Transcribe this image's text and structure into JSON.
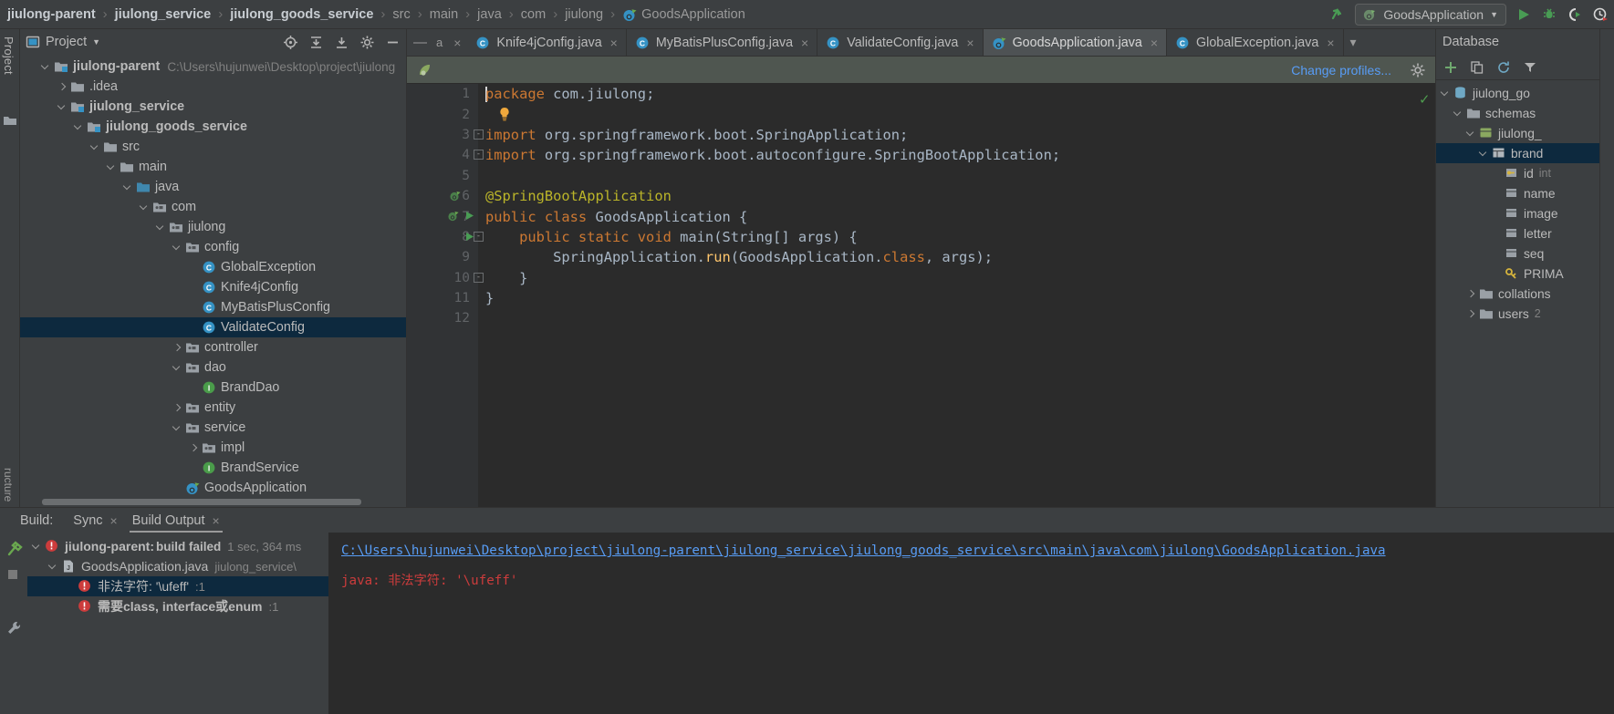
{
  "navbar": {
    "breadcrumbs": [
      {
        "label": "jiulong-parent",
        "style": "bold"
      },
      {
        "label": "jiulong_service",
        "style": "bold"
      },
      {
        "label": "jiulong_goods_service",
        "style": "bold"
      },
      {
        "label": "src",
        "style": "dim"
      },
      {
        "label": "main",
        "style": "dim"
      },
      {
        "label": "java",
        "style": "dim"
      },
      {
        "label": "com",
        "style": "dim"
      },
      {
        "label": "jiulong",
        "style": "dim"
      },
      {
        "label": "GoodsApplication",
        "style": "dim"
      }
    ],
    "separator": "›",
    "run_config": "GoodsApplication",
    "dropdown_glyph": "▼",
    "icons": [
      "updown-arrow-icon",
      "run-icon",
      "debug-icon",
      "run-coverage-icon",
      "profile-icon"
    ]
  },
  "left_strip": {
    "label": "Project",
    "bottom_label": "ructure"
  },
  "project": {
    "title": "Project",
    "dropdown_glyph": "▼",
    "header_icons": [
      "locate-icon",
      "expand-all-icon",
      "collapse-all-icon",
      "settings-icon",
      "hide-icon"
    ],
    "tree": [
      {
        "indent": 0,
        "arrow": "down",
        "icon": "module-folder",
        "label": "jiulong-parent",
        "bold": true,
        "path": "C:\\Users\\hujunwei\\Desktop\\project\\jiulong"
      },
      {
        "indent": 1,
        "arrow": "right",
        "icon": "folder",
        "label": ".idea",
        "bold": false
      },
      {
        "indent": 1,
        "arrow": "down",
        "icon": "module-folder",
        "label": "jiulong_service",
        "bold": true
      },
      {
        "indent": 2,
        "arrow": "down",
        "icon": "module-folder",
        "label": "jiulong_goods_service",
        "bold": true
      },
      {
        "indent": 3,
        "arrow": "down",
        "icon": "folder",
        "label": "src",
        "bold": false
      },
      {
        "indent": 4,
        "arrow": "down",
        "icon": "folder",
        "label": "main",
        "bold": false
      },
      {
        "indent": 5,
        "arrow": "down",
        "icon": "source-folder",
        "label": "java",
        "bold": false
      },
      {
        "indent": 6,
        "arrow": "down",
        "icon": "package",
        "label": "com",
        "bold": false
      },
      {
        "indent": 7,
        "arrow": "down",
        "icon": "package",
        "label": "jiulong",
        "bold": false
      },
      {
        "indent": 8,
        "arrow": "down",
        "icon": "package",
        "label": "config",
        "bold": false
      },
      {
        "indent": 9,
        "arrow": "none",
        "icon": "class",
        "label": "GlobalException",
        "bold": false
      },
      {
        "indent": 9,
        "arrow": "none",
        "icon": "class",
        "label": "Knife4jConfig",
        "bold": false
      },
      {
        "indent": 9,
        "arrow": "none",
        "icon": "class",
        "label": "MyBatisPlusConfig",
        "bold": false
      },
      {
        "indent": 9,
        "arrow": "none",
        "icon": "class",
        "label": "ValidateConfig",
        "bold": false,
        "selected": true
      },
      {
        "indent": 8,
        "arrow": "right",
        "icon": "package",
        "label": "controller",
        "bold": false
      },
      {
        "indent": 8,
        "arrow": "down",
        "icon": "package",
        "label": "dao",
        "bold": false
      },
      {
        "indent": 9,
        "arrow": "none",
        "icon": "interface",
        "label": "BrandDao",
        "bold": false
      },
      {
        "indent": 8,
        "arrow": "right",
        "icon": "package",
        "label": "entity",
        "bold": false
      },
      {
        "indent": 8,
        "arrow": "down",
        "icon": "package",
        "label": "service",
        "bold": false
      },
      {
        "indent": 9,
        "arrow": "right",
        "icon": "package",
        "label": "impl",
        "bold": false
      },
      {
        "indent": 9,
        "arrow": "none",
        "icon": "interface",
        "label": "BrandService",
        "bold": false
      },
      {
        "indent": 8,
        "arrow": "none",
        "icon": "spring-class",
        "label": "GoodsApplication",
        "bold": false
      }
    ]
  },
  "editor": {
    "tabs": [
      {
        "label": "Knife4jConfig.java",
        "icon": "class",
        "active": false
      },
      {
        "label": "MyBatisPlusConfig.java",
        "icon": "class",
        "active": false
      },
      {
        "label": "ValidateConfig.java",
        "icon": "class",
        "active": false
      },
      {
        "label": "GoodsApplication.java",
        "icon": "spring-class",
        "active": true
      },
      {
        "label": "GlobalException.java",
        "icon": "class",
        "active": false
      }
    ],
    "tab_close_glyph": "×",
    "tab_overflow_glyph": "▾",
    "notification": {
      "icon": "spring-leaf-icon",
      "link": "Change profiles...",
      "gear": "gear-icon"
    },
    "line_numbers": [
      "1",
      "2",
      "3",
      "4",
      "5",
      "6",
      "7",
      "8",
      "9",
      "10",
      "11",
      "12"
    ],
    "code_lines": [
      {
        "n": 1,
        "tokens": [
          {
            "t": "package ",
            "c": "kw"
          },
          {
            "t": "com.jiulong;",
            "c": "plain"
          }
        ]
      },
      {
        "n": 2,
        "tokens": []
      },
      {
        "n": 3,
        "tokens": [
          {
            "t": "import ",
            "c": "kw"
          },
          {
            "t": "org.springframework.boot.SpringApplication;",
            "c": "plain"
          }
        ]
      },
      {
        "n": 4,
        "tokens": [
          {
            "t": "import ",
            "c": "kw"
          },
          {
            "t": "org.springframework.boot.autoconfigure.SpringBootApplication;",
            "c": "plain"
          }
        ]
      },
      {
        "n": 5,
        "tokens": []
      },
      {
        "n": 6,
        "tokens": [
          {
            "t": "@SpringBootApplication",
            "c": "ann"
          }
        ]
      },
      {
        "n": 7,
        "tokens": [
          {
            "t": "public class ",
            "c": "kw"
          },
          {
            "t": "GoodsApplication {",
            "c": "plain"
          }
        ]
      },
      {
        "n": 8,
        "tokens": [
          {
            "t": "    public static void ",
            "c": "kw"
          },
          {
            "t": "main(String[] args) {",
            "c": "plain"
          }
        ]
      },
      {
        "n": 9,
        "tokens": [
          {
            "t": "        SpringApplication.",
            "c": "plain"
          },
          {
            "t": "run",
            "c": "method"
          },
          {
            "t": "(GoodsApplication.",
            "c": "plain"
          },
          {
            "t": "class",
            "c": "kw"
          },
          {
            "t": ", args);",
            "c": "plain"
          }
        ]
      },
      {
        "n": 10,
        "tokens": [
          {
            "t": "    }",
            "c": "plain"
          }
        ]
      },
      {
        "n": 11,
        "tokens": [
          {
            "t": "}",
            "c": "plain"
          }
        ]
      },
      {
        "n": 12,
        "tokens": []
      }
    ],
    "gutter_marks": [
      {
        "line": 6,
        "icon": "spring-bean-icon"
      },
      {
        "line": 7,
        "icon": "spring-bean-icon"
      },
      {
        "line": 7,
        "icon": "run-gutter-icon"
      },
      {
        "line": 8,
        "icon": "run-gutter-icon"
      }
    ],
    "inspection_status": "✓"
  },
  "database": {
    "title": "Database",
    "toolbar_icons": [
      "add-icon",
      "copy-icon",
      "refresh-icon",
      "filter-icon"
    ],
    "tree": [
      {
        "indent": 0,
        "arrow": "down",
        "icon": "datasource",
        "label": "jiulong_go"
      },
      {
        "indent": 1,
        "arrow": "down",
        "icon": "folder",
        "label": "schemas"
      },
      {
        "indent": 2,
        "arrow": "down",
        "icon": "schema",
        "label": "jiulong_"
      },
      {
        "indent": 3,
        "arrow": "down",
        "icon": "table",
        "label": "brand",
        "selected": true
      },
      {
        "indent": 4,
        "arrow": "none",
        "icon": "key-column",
        "label": "id",
        "sub": "int"
      },
      {
        "indent": 4,
        "arrow": "none",
        "icon": "column",
        "label": "name"
      },
      {
        "indent": 4,
        "arrow": "none",
        "icon": "column",
        "label": "image"
      },
      {
        "indent": 4,
        "arrow": "none",
        "icon": "column",
        "label": "letter"
      },
      {
        "indent": 4,
        "arrow": "none",
        "icon": "column",
        "label": "seq"
      },
      {
        "indent": 4,
        "arrow": "none",
        "icon": "index",
        "label": "PRIMA"
      },
      {
        "indent": 2,
        "arrow": "right",
        "icon": "folder",
        "label": "collations"
      },
      {
        "indent": 2,
        "arrow": "right",
        "icon": "folder",
        "label": "users",
        "sub": "2"
      }
    ]
  },
  "build": {
    "label": "Build:",
    "tabs": [
      {
        "label": "Sync",
        "active": false,
        "close": "×"
      },
      {
        "label": "Build Output",
        "active": true,
        "close": "×"
      }
    ],
    "tree": [
      {
        "indent": 0,
        "arrow": "down",
        "icon": "error",
        "label": "jiulong-parent:",
        "label2": "build failed",
        "time": "1 sec, 364 ms",
        "bold": true
      },
      {
        "indent": 1,
        "arrow": "down",
        "icon": "java-file",
        "label": "GoodsApplication.java",
        "sub": "jiulong_service\\",
        "bold": false
      },
      {
        "indent": 2,
        "arrow": "none",
        "icon": "error",
        "label": "非法字符: '\\ufeff'",
        "sub": ":1",
        "selected": true
      },
      {
        "indent": 2,
        "arrow": "none",
        "icon": "error",
        "label": "需要class, interface或enum",
        "sub": ":1",
        "bold": true
      }
    ],
    "console": {
      "path": "C:\\Users\\hujunwei\\Desktop\\project\\jiulong-parent\\jiulong_service\\jiulong_goods_service\\src\\main\\java\\com\\jiulong\\GoodsApplication.java",
      "error": "java: 非法字符: '\\ufeff'"
    },
    "side_icons": [
      "build-hammer-icon",
      "stop-icon",
      "wrench-icon"
    ]
  },
  "colors": {
    "accent_blue": "#3592c4",
    "link_blue": "#589df6",
    "error_red": "#cc3c3c",
    "green": "#499c54",
    "keyword_orange": "#cc7832",
    "annotation_yellow": "#bbb529",
    "selection": "#0d293e"
  }
}
